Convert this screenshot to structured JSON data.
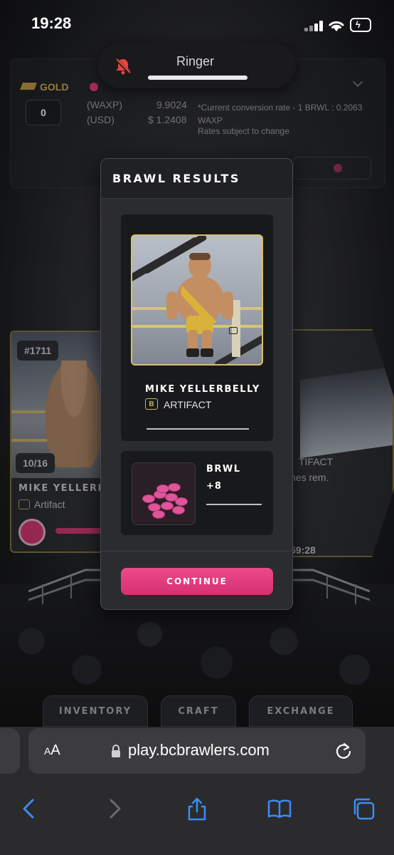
{
  "status_bar": {
    "time": "19:28"
  },
  "ringer": {
    "label": "Ringer"
  },
  "top_panel": {
    "gold_label": "GOLD",
    "gold_value": "0",
    "waxp_label": "(WAXP)",
    "waxp_value": "9.9024",
    "usd_label": "(USD)",
    "usd_value": "$ 1.2408",
    "conversion_note": "*Current conversion rate - 1 BRWL : 0.2063 WAXP",
    "rates_note": "Rates subject to change"
  },
  "left_card": {
    "id": "#1711",
    "count": "10/16",
    "name": "MIKE YELLERB",
    "rarity": "Artifact"
  },
  "right_card": {
    "rarity_partial": "TIFACT",
    "uses_partial": "nes rem.",
    "timer_partial": "59:28"
  },
  "modal": {
    "title": "BRAWL RESULTS",
    "card": {
      "name": "MIKE YELLERBELLY",
      "rarity": "ARTIFACT"
    },
    "reward": {
      "name": "BRWL",
      "amount": "+8"
    },
    "continue_label": "CONTINUE"
  },
  "game_tabs": [
    "INVENTORY",
    "CRAFT",
    "EXCHANGE"
  ],
  "browser": {
    "aa_label": "AA",
    "url": "play.bcbrawlers.com"
  },
  "colors": {
    "accent_pink": "#e4336f",
    "gold": "#d9bd6a",
    "ios_blue": "#3d8bf6"
  },
  "icons": {
    "ringer": "bell-slash-icon",
    "lock": "lock-icon",
    "reload": "reload-icon",
    "back": "chevron-left-icon",
    "forward": "chevron-right-icon",
    "share": "share-icon",
    "bookmarks": "book-icon",
    "tabs": "tabs-icon"
  }
}
